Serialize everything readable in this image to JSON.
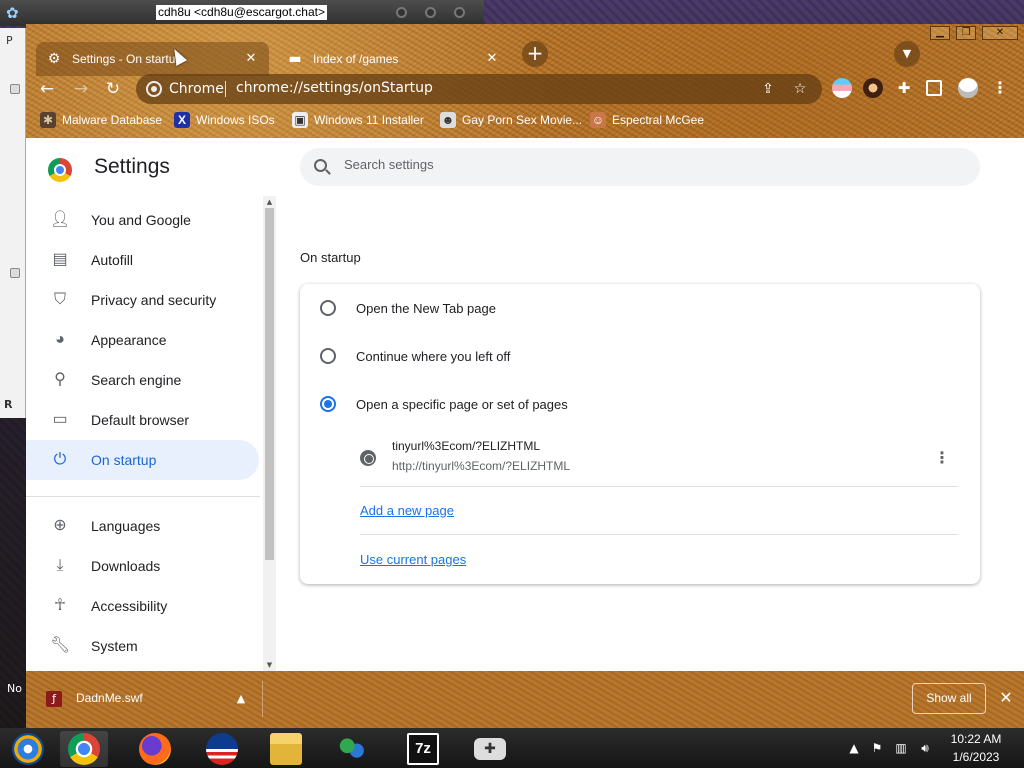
{
  "messenger": {
    "title": "cdh8u <cdh8u@escargot.chat>"
  },
  "background_window": {
    "tab_fragment": "P",
    "caption_fragment": "R"
  },
  "desktop": {
    "label_fragment": "No"
  },
  "browser": {
    "tabs": [
      {
        "title": "Settings - On startup",
        "icon": "gear-icon",
        "active": true
      },
      {
        "title": "Index of /games",
        "icon": "folder-icon",
        "active": false
      }
    ],
    "omnibox": {
      "chip": "Chrome",
      "url": "chrome://settings/onStartup"
    },
    "bookmarks": [
      {
        "label": "Malware Database",
        "icon": "bug-icon"
      },
      {
        "label": "Windows ISOs",
        "icon": "x-logo-icon"
      },
      {
        "label": "Windows 11 Installer",
        "icon": "image-icon"
      },
      {
        "label": "Gay Porn Sex Movie...",
        "icon": "mask-icon"
      },
      {
        "label": "Espectral McGee",
        "icon": "character-icon"
      }
    ]
  },
  "settings": {
    "title": "Settings",
    "search_placeholder": "Search settings",
    "nav": [
      {
        "label": "You and Google",
        "icon": "person-icon",
        "active": false
      },
      {
        "label": "Autofill",
        "icon": "clipboard-icon",
        "active": false
      },
      {
        "label": "Privacy and security",
        "icon": "shield-icon",
        "active": false
      },
      {
        "label": "Appearance",
        "icon": "palette-icon",
        "active": false
      },
      {
        "label": "Search engine",
        "icon": "search-icon",
        "active": false
      },
      {
        "label": "Default browser",
        "icon": "browser-window-icon",
        "active": false
      },
      {
        "label": "On startup",
        "icon": "power-icon",
        "active": true
      },
      {
        "label": "Languages",
        "icon": "globe-icon",
        "active": false
      },
      {
        "label": "Downloads",
        "icon": "download-icon",
        "active": false
      },
      {
        "label": "Accessibility",
        "icon": "accessibility-icon",
        "active": false
      },
      {
        "label": "System",
        "icon": "wrench-icon",
        "active": false
      }
    ],
    "section_title": "On startup",
    "options": [
      {
        "label": "Open the New Tab page",
        "checked": false
      },
      {
        "label": "Continue where you left off",
        "checked": false
      },
      {
        "label": "Open a specific page or set of pages",
        "checked": true
      }
    ],
    "startup_page": {
      "name": "tinyurl%3Ecom/?ELIZHTML",
      "url": "http://tinyurl%3Ecom/?ELIZHTML"
    },
    "add_page_link": "Add a new page",
    "use_current_link": "Use current pages"
  },
  "download_shelf": {
    "file_name": "DadnMe.swf",
    "show_all_label": "Show all"
  },
  "taskbar": {
    "apps": [
      "windows-start-icon",
      "chrome-icon",
      "firefox-icon",
      "obama-logo-icon",
      "file-explorer-icon",
      "msn-messenger-icon",
      "7zip-icon",
      "gamepad-icon"
    ],
    "seven_zip_label": "7z",
    "time": "10:22 AM",
    "date": "1/6/2023"
  },
  "colors": {
    "accent": "#1a73e8",
    "frame": "#b8772c",
    "active_nav_bg": "#e8f0fe"
  }
}
